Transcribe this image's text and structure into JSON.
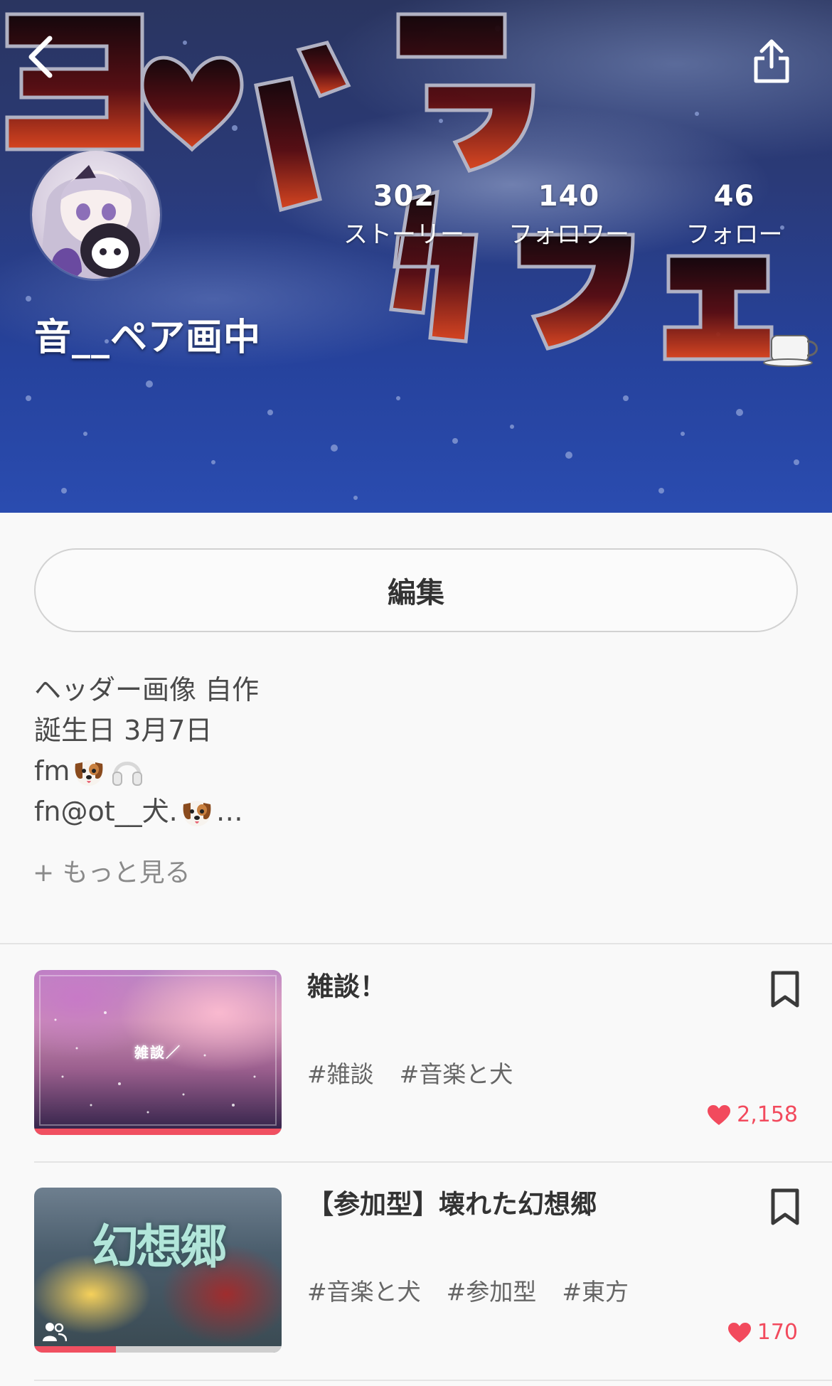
{
  "profile": {
    "username": "音__ペア画中",
    "stats": [
      {
        "value": "302",
        "label": "ストーリー"
      },
      {
        "value": "140",
        "label": "フォロワー"
      },
      {
        "value": "46",
        "label": "フォロー"
      }
    ]
  },
  "edit_label": "編集",
  "bio": {
    "line1": "ヘッダー画像 自作",
    "line2": "誕生日 3月7日",
    "line3": "fm",
    "line4a": "fn@ot__犬.",
    "line4b": "…",
    "more": "+ もっと見る"
  },
  "stories": [
    {
      "title": "雑談！",
      "thumb_text": "雑談／",
      "tags": [
        "#雑談",
        "#音楽と犬"
      ],
      "likes": "2,158",
      "progress": 1.0
    },
    {
      "title": "【参加型】壊れた幻想郷",
      "thumb_text": "幻想郷",
      "tags": [
        "#音楽と犬",
        "#参加型",
        "#東方"
      ],
      "likes": "170",
      "progress": 0.33
    }
  ],
  "colors": {
    "accent": "#f24a5d",
    "progress": "#f05061",
    "text": "#333333"
  },
  "icons": {
    "back": "chevron-left-icon",
    "share": "share-icon",
    "bookmark": "bookmark-icon",
    "heart": "heart-icon",
    "pair": "pair-users-icon",
    "bio_emoji": [
      "dog-face-icon",
      "headphones-icon",
      "dog-face-icon"
    ]
  }
}
